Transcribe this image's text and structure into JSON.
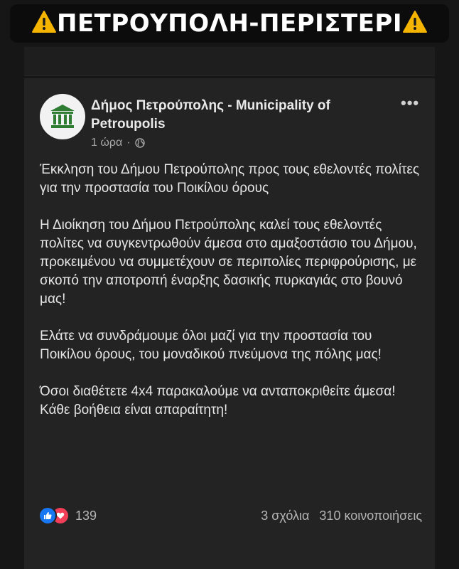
{
  "banner": {
    "text": "ΠΕΤΡΟΥΠΟΛΗ-ΠΕΡΙΣΤΕΡΙ",
    "icon": "warning-icon"
  },
  "post": {
    "page_name": "Δήμος Πετρούπολης - Municipality of Petroupolis",
    "time": "1 ώρα",
    "separator": "·",
    "audience_icon": "globe-icon",
    "paragraphs": [
      "Έκκληση του Δήμου Πετρούπολης προς τους εθελοντές πολίτες για την προστασία του Ποικίλου όρους",
      "Η Διοίκηση του Δήμου Πετρούπολης καλεί τους εθελοντές πολίτες να συγκεντρωθούν άμεσα στο αμαξοστάσιο του Δήμου, προκειμένου να συμμετέχουν σε περιπολίες περιφρούρισης, με σκοπό την αποτροπή έναρξης δασικής πυρκαγιάς στο βουνό μας!",
      "Ελάτε να συνδράμουμε όλοι μαζί για την προστασία του Ποικίλου όρους, του μοναδικού πνεύμονα της πόλης μας!",
      "Όσοι διαθέτετε 4x4 παρακαλούμε να ανταποκριθείτε άμεσα! Κάθε βοήθεια είναι απαραίτητη!"
    ],
    "reactions_count": "139",
    "comments": "3 σχόλια",
    "shares": "310 κοινοποιήσεις"
  },
  "colors": {
    "background": "#161617",
    "card": "#232324",
    "like": "#1877f2",
    "love": "#f33e58",
    "warning": "#f5b400"
  }
}
